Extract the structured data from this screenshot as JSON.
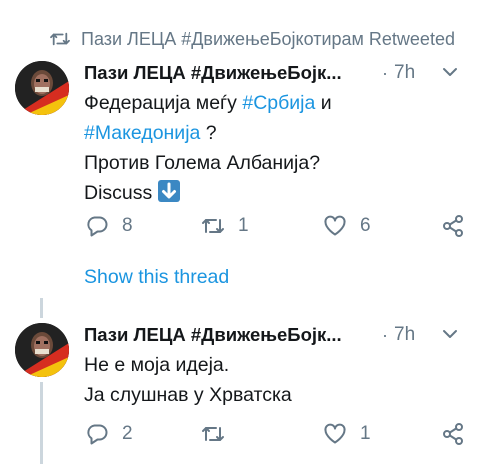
{
  "retweet_banner": {
    "icon": "retweet-icon",
    "text": "Пази ЛЕЦА #ДвижењеБојкотирам Retweeted"
  },
  "tweets": [
    {
      "author_name": "Пази ЛЕЦА #ДвижењеБојк...",
      "separator": "·",
      "time": "7h",
      "text": {
        "line1_prefix": "Федерација меѓу ",
        "line1_hashtag": "#Србија",
        "line1_suffix": " и",
        "line2_hashtag": "#Македонија",
        "line2_suffix": " ?",
        "line3": "Против Голема Албанија?",
        "line4": "Discuss ",
        "emoji": "down-arrow-emoji"
      },
      "actions": {
        "replies": "8",
        "retweets": "1",
        "likes": "6"
      },
      "show_thread": "Show this thread"
    },
    {
      "author_name": "Пази ЛЕЦА #ДвижењеБојк...",
      "separator": "·",
      "time": "7h",
      "text": {
        "line1": "Не е моја идеја.",
        "line2": "Ја слушнав у Хрватска"
      },
      "actions": {
        "replies": "2",
        "retweets": "",
        "likes": "1"
      }
    }
  ],
  "colors": {
    "link": "#1b95e0",
    "muted": "#657786",
    "thread_line": "#ccd6dd",
    "text": "#14171a"
  }
}
